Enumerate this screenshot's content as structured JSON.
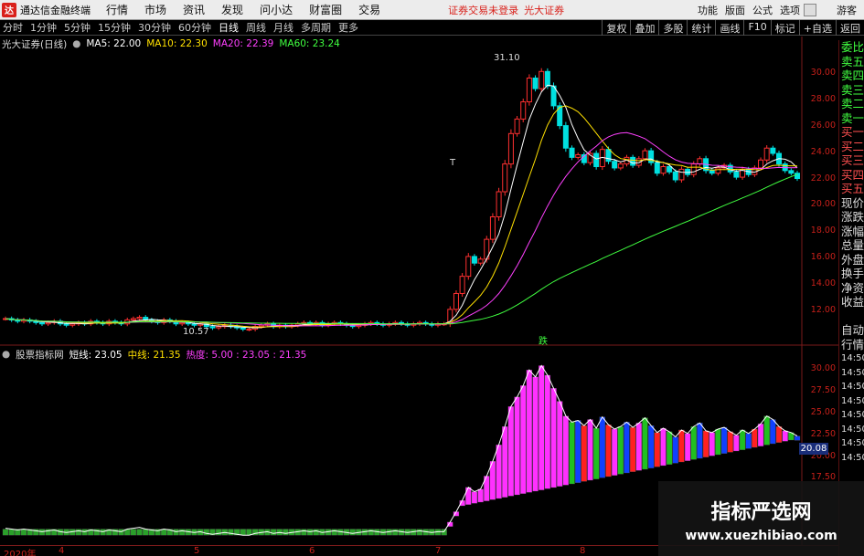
{
  "menubar": {
    "app_name": "通达信金融终端",
    "items": [
      "行情",
      "市场",
      "资讯",
      "发现",
      "问小达",
      "财富圈",
      "交易"
    ],
    "notice": "证券交易未登录",
    "broker": "光大证券",
    "right_items": [
      "功能",
      "版面",
      "公式",
      "选项"
    ],
    "guest": "游客"
  },
  "toolbar": {
    "periods": [
      "分时",
      "1分钟",
      "5分钟",
      "15分钟",
      "30分钟",
      "60分钟",
      "日线",
      "周线",
      "月线",
      "多周期",
      "更多"
    ],
    "active_period": "日线",
    "right_tools": [
      "复权",
      "叠加",
      "多股",
      "统计",
      "画线",
      "F10",
      "标记",
      "+自选",
      "返回"
    ]
  },
  "main_chart": {
    "stock_name": "光大证券(日线)",
    "ma": [
      {
        "label": "MA5: 22.00",
        "color": "#ffffff"
      },
      {
        "label": "MA10: 22.30",
        "color": "#ffe000"
      },
      {
        "label": "MA20: 22.39",
        "color": "#ff40ff"
      },
      {
        "label": "MA60: 23.24",
        "color": "#40ff40"
      }
    ],
    "high_label": "31.10",
    "low_label": "10.57",
    "marker_t": "T",
    "marker_die": "跌",
    "y_ticks": [
      "30.00",
      "28.00",
      "26.00",
      "24.00",
      "22.00",
      "20.00",
      "18.00",
      "16.00",
      "14.00",
      "12.00"
    ]
  },
  "sub_chart": {
    "name": "股票指标网",
    "params": [
      {
        "label": "短线: 23.05",
        "color": "#ffffff"
      },
      {
        "label": "中线: 21.35",
        "color": "#ffe000"
      },
      {
        "label": "热度: 5.00 : 23.05 : 21.35",
        "color": "#ff40ff"
      }
    ],
    "y_ticks": [
      "30.00",
      "27.50",
      "25.00",
      "22.50",
      "20.00",
      "17.50"
    ],
    "last_value": "20.08"
  },
  "side_panel": [
    "委比",
    "卖五",
    "卖四",
    "卖三",
    "卖二",
    "卖一",
    "买一",
    "买二",
    "买三",
    "买四",
    "买五",
    "现价",
    "涨跌",
    "涨幅",
    "总量",
    "外盘",
    "换手",
    "净资",
    "收益",
    "",
    "自动",
    "行情",
    "14:50",
    "14:50",
    "14:50",
    "14:50",
    "14:50",
    "14:50",
    "14:50",
    "14:50"
  ],
  "bottom_axis": [
    "2020年",
    "4",
    "5",
    "6",
    "7",
    "8"
  ],
  "watermark": {
    "title": "指标严选网",
    "url": "www.xuezhibiao.com"
  },
  "chart_data": {
    "type": "candlestick",
    "ylim": [
      10.5,
      31.5
    ],
    "close": [
      11.4,
      11.3,
      11.2,
      11.3,
      11.2,
      11.1,
      11.0,
      11.1,
      11.2,
      11.0,
      10.9,
      11.0,
      11.1,
      11.0,
      11.2,
      11.1,
      11.0,
      11.2,
      11.1,
      11.0,
      11.3,
      11.4,
      11.5,
      11.3,
      11.2,
      11.1,
      11.3,
      11.2,
      11.0,
      11.1,
      11.0,
      10.9,
      11.0,
      10.8,
      10.7,
      10.8,
      10.9,
      10.8,
      10.7,
      10.6,
      10.6,
      10.8,
      10.9,
      11.0,
      10.8,
      10.9,
      10.8,
      10.9,
      11.0,
      11.1,
      11.0,
      11.1,
      10.9,
      11.0,
      11.1,
      11.0,
      10.9,
      10.8,
      10.9,
      11.0,
      11.1,
      11.0,
      10.9,
      11.0,
      11.1,
      11.0,
      10.9,
      11.0,
      11.1,
      11.0,
      10.9,
      11.0,
      11.0,
      12.1,
      13.3,
      14.6,
      16.1,
      15.6,
      15.9,
      17.4,
      19.1,
      21.0,
      23.1,
      25.4,
      26.5,
      27.8,
      29.6,
      28.8,
      30.1,
      29.0,
      27.5,
      26.0,
      24.3,
      23.6,
      23.8,
      23.2,
      23.9,
      22.9,
      24.2,
      23.3,
      22.8,
      23.1,
      23.6,
      23.0,
      23.5,
      24.1,
      23.2,
      22.4,
      22.9,
      22.5,
      21.9,
      22.7,
      22.3,
      23.1,
      23.5,
      22.6,
      22.4,
      22.8,
      23.0,
      22.5,
      22.1,
      22.7,
      22.3,
      22.8,
      23.4,
      24.3,
      23.9,
      23.1,
      22.6,
      22.4,
      22.0
    ]
  }
}
